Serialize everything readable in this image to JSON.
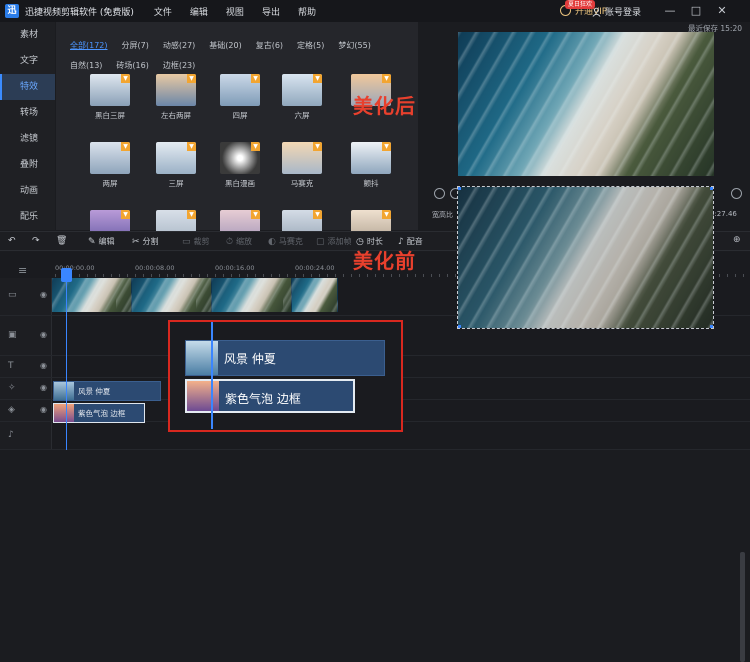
{
  "app": {
    "title": "迅捷视频剪辑软件 (免费版)",
    "logo_glyph": "迅"
  },
  "menu": [
    "文件",
    "编辑",
    "视图",
    "导出",
    "帮助"
  ],
  "titlebar_right": {
    "vip_label": "开通VIP",
    "vip_badge": "夏日狂欢",
    "login_label": "账号登录",
    "window_buttons": [
      "—",
      "□",
      "✕"
    ]
  },
  "left_nav": {
    "items": [
      "素材",
      "文字",
      "特效",
      "转场",
      "滤镜",
      "叠附",
      "动画",
      "配乐"
    ],
    "active_index": 2
  },
  "effects_panel": {
    "categories": [
      "全部(172)",
      "分屏(7)",
      "动感(27)",
      "基础(20)",
      "复古(6)",
      "定格(5)",
      "梦幻(55)",
      "自然(13)",
      "砖场(16)",
      "边框(23)"
    ],
    "active_category": 0,
    "items": [
      "黑白三屏",
      "左右两屏",
      "四屏",
      "六屏",
      "",
      "两屏",
      "三屏",
      "黑白漫画",
      "马赛克",
      "颤抖",
      "",
      "",
      "",
      "",
      ""
    ],
    "download_badge": "▼"
  },
  "preview": {
    "last_saved": "最近保存 15:20",
    "after_label": "美化后",
    "before_label": "美化前",
    "ratio_label": "宽高比",
    "time_label": "0:27.46"
  },
  "toolbar": {
    "items": [
      {
        "icon": "↶",
        "label": ""
      },
      {
        "icon": "↷",
        "label": ""
      },
      {
        "icon": "🗑",
        "label": ""
      },
      {
        "icon": "✎",
        "label": "编辑"
      },
      {
        "icon": "✂",
        "label": "分割"
      },
      {
        "icon": "▭",
        "label": "裁剪"
      },
      {
        "icon": "⏱",
        "label": "缩放"
      },
      {
        "icon": "◐",
        "label": "马赛克"
      },
      {
        "icon": "▢",
        "label": "添加帧"
      },
      {
        "icon": "◷",
        "label": "时长"
      },
      {
        "icon": "♪",
        "label": "配音"
      }
    ]
  },
  "timeline": {
    "ticks": [
      "00:00:00.00",
      "00:00:08.00",
      "00:00:16.00",
      "00:00:24.00"
    ],
    "text_clip_label": "风景  仲夏",
    "border_clip_label": "紫色气泡  边框",
    "zoom_text_clip_label": "风景  仲夏",
    "zoom_border_clip_label": "紫色气泡 边框"
  },
  "colors": {
    "accent": "#3a86ff",
    "highlight_red": "#d8281f",
    "label_red": "#e8402d",
    "clip_blue": "#2c4a72"
  }
}
